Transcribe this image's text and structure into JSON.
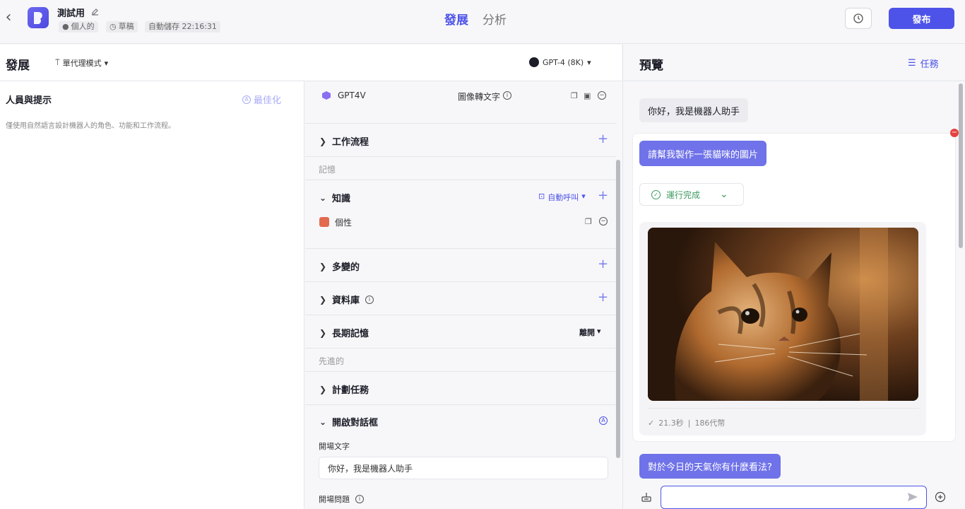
{
  "header": {
    "app_title": "測試用",
    "tags": [
      "個人的",
      "草稿",
      "自動儲存 22:16:31"
    ],
    "nav_tabs": [
      "發展",
      "分析"
    ],
    "publish_label": "發布"
  },
  "dev": {
    "title": "發展",
    "mode_label": "單代理模式",
    "model_label": "GPT-4 (8K)",
    "persona_title": "人員與提示",
    "optimize_label": "最佳化",
    "persona_placeholder": "僅使用自然語言設計機器人的角色、功能和工作流程。"
  },
  "skills": {
    "plugin_name": "GPT4V",
    "plugin_desc": "圖像轉文字",
    "workflow_label": "工作流程",
    "memory_group": "記憶",
    "knowledge_label": "知識",
    "auto_call_label": "自動呼叫",
    "knowledge_item": "個性",
    "variables_label": "多變的",
    "database_label": "資料庫",
    "long_memory_label": "長期記憶",
    "long_memory_value": "離開",
    "advanced_group": "先進的",
    "plan_label": "計劃任務",
    "opening_label": "開啟對話框",
    "opening_text_label": "開場文字",
    "opening_text_value": "你好，我是機器人助手",
    "opening_q_label": "開場問題"
  },
  "preview": {
    "title": "預覽",
    "task_label": "任務",
    "msg1": "你好，我是機器人助手",
    "msg2": "請幫我製作一張貓咪的圖片",
    "status": "運行完成",
    "meta_time": "21.3秒",
    "meta_sep": "|",
    "meta_tokens": "186代幣",
    "msg3": "對於今日的天氣你有什麼看法?"
  },
  "colors": {
    "accent": "#4d53e8",
    "bubble": "#6f72e8",
    "success": "#3c9a5f"
  }
}
